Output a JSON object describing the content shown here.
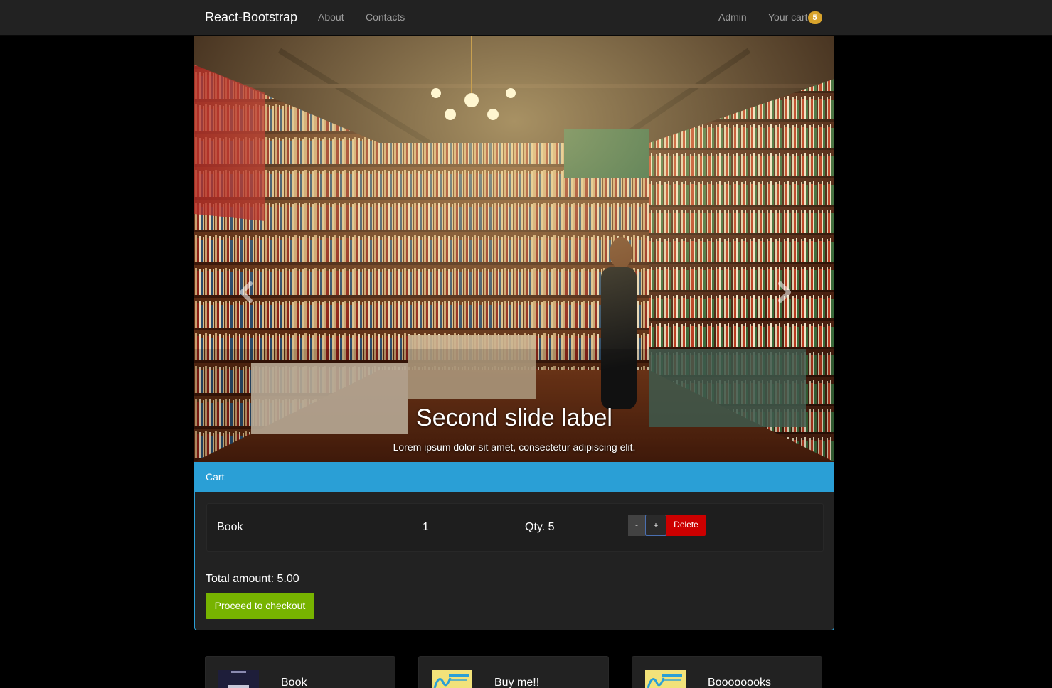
{
  "navbar": {
    "brand": "React-Bootstrap",
    "links": [
      "About",
      "Contacts"
    ],
    "admin": "Admin",
    "cart_label": "Your cart",
    "cart_count": "5"
  },
  "carousel": {
    "caption_title": "Second slide label",
    "caption_text": "Lorem ipsum dolor sit amet, consectetur adipiscing elit.",
    "slide_count": 2,
    "active_slide": 2
  },
  "cart": {
    "heading": "Cart",
    "items": [
      {
        "title": "Book",
        "price": "1",
        "qty": "Qty. 5"
      }
    ],
    "buttons": {
      "minus": "-",
      "plus": "+",
      "delete": "Delete"
    },
    "total": "Total amount: 5.00",
    "checkout": "Proceed to checkout"
  },
  "products": [
    {
      "title": "Book"
    },
    {
      "title": "Buy me!!"
    },
    {
      "title": "Boooooooks"
    }
  ],
  "colors": {
    "accent": "#2a9fd6",
    "success": "#77b300",
    "danger": "#cc0000",
    "badge": "#d8a32c"
  }
}
